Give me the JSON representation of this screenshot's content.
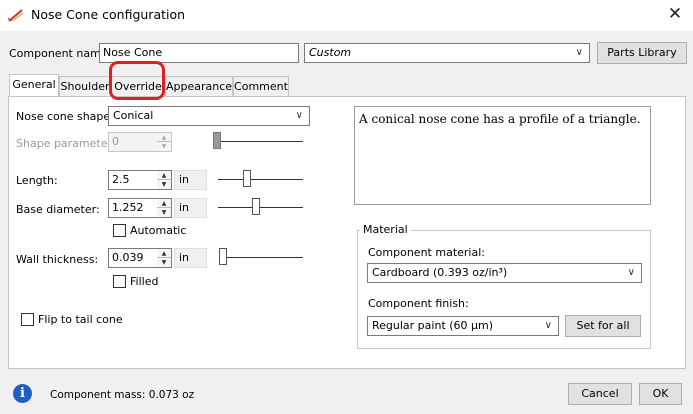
{
  "window": {
    "title": "Nose Cone configuration",
    "icon": "rocket-icon",
    "close_label": "✕"
  },
  "header": {
    "component_name_label": "Component name:",
    "component_name_value": "Nose Cone",
    "preset_value": "Custom",
    "parts_library_label": "Parts Library"
  },
  "tabs": [
    {
      "label": "General",
      "active": true
    },
    {
      "label": "Shoulder",
      "active": false
    },
    {
      "label": "Override",
      "active": false
    },
    {
      "label": "Appearance",
      "active": false
    },
    {
      "label": "Comment",
      "active": false
    }
  ],
  "general": {
    "shape_label": "Nose cone shape:",
    "shape_value": "Conical",
    "shape_param_label": "Shape parameter:",
    "shape_param_value": "0",
    "length_label": "Length:",
    "length_value": "2.5",
    "length_unit": "in",
    "base_diameter_label": "Base diameter:",
    "base_diameter_value": "1.252",
    "base_diameter_unit": "in",
    "automatic_label": "Automatic",
    "wall_label": "Wall thickness:",
    "wall_value": "0.039",
    "wall_unit": "in",
    "filled_label": "Filled",
    "flip_label": "Flip to tail cone",
    "description": "A conical nose cone has a profile of a triangle."
  },
  "material": {
    "group_title": "Material",
    "component_material_label": "Component material:",
    "component_material_value": "Cardboard (0.393 oz/in³)",
    "component_finish_label": "Component finish:",
    "component_finish_value": "Regular paint (60 μm)",
    "set_for_all_label": "Set for all"
  },
  "footer": {
    "mass_text": "Component mass: 0.073 oz",
    "cancel_label": "Cancel",
    "ok_label": "OK"
  },
  "colors": {
    "highlight": "#e02020",
    "info_icon": "#1f5fbf"
  }
}
